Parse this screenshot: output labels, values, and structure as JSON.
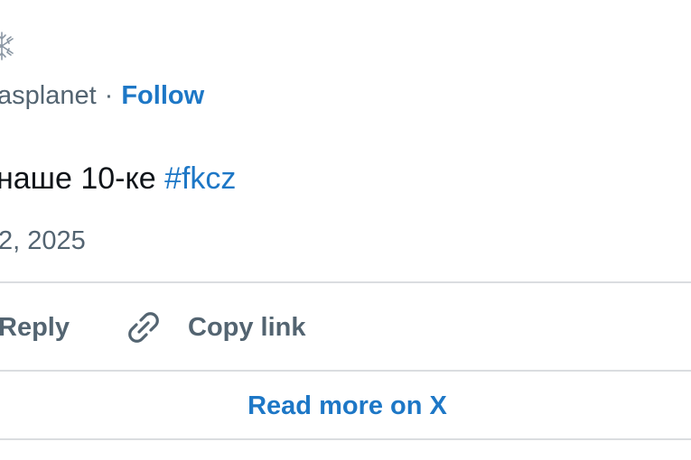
{
  "author": {
    "avatar_icon": "snowflake-icon",
    "handle_partial": "asplanet",
    "separator": "·",
    "follow_label": "Follow"
  },
  "tweet": {
    "text_partial": "наше 10-ке",
    "hashtag": "#fkcz",
    "date_partial": "2, 2025"
  },
  "actions": {
    "reply_label": "Reply",
    "copy_link_icon": "link-icon",
    "copy_link_label": "Copy link"
  },
  "footer": {
    "read_more_label": "Read more on X"
  },
  "colors": {
    "link_blue": "#1d77c6",
    "text_primary": "#0f1419",
    "text_secondary": "#536471",
    "divider": "#dadde0"
  }
}
